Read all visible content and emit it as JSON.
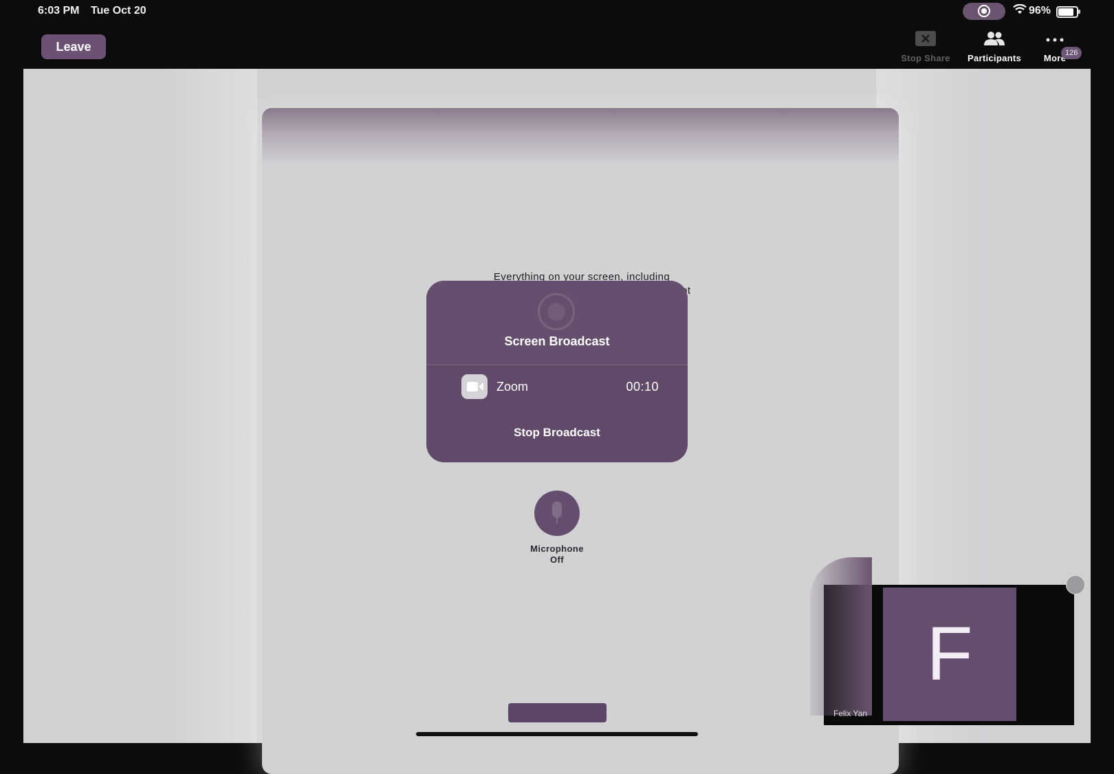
{
  "status_bar": {
    "time": "6:03 PM",
    "date": "Tue Oct 20",
    "battery": "96%"
  },
  "toolbar": {
    "leave_label": "Leave",
    "stop_share_label": "Stop Share",
    "participants_label": "Participants",
    "more_label": "More",
    "participant_count": "126"
  },
  "broadcast": {
    "message": "Everything on your screen, including\nnotifications, will be recorded. Enable Do Not\nDisturb to prevent unexpected notifications.",
    "title": "Screen Broadcast",
    "app_name": "Zoom",
    "timer": "00:10",
    "stop_label": "Stop Broadcast"
  },
  "microphone": {
    "label": "Microphone\nOff"
  },
  "self_video": {
    "avatar_initial": "F",
    "name": "Felix Yan"
  },
  "colors": {
    "accent": "#654e6d",
    "background": "#d1d0d3"
  },
  "icons": [
    "screen-record-icon",
    "wifi-icon",
    "battery-icon",
    "stop-share-icon",
    "participants-icon",
    "more-icon",
    "record-icon",
    "zoom-app-icon",
    "microphone-icon"
  ]
}
